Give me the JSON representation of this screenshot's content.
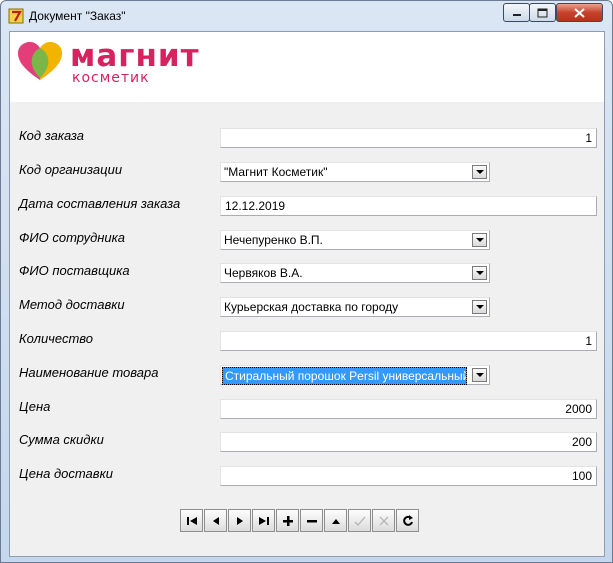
{
  "window": {
    "title": "Документ \"Заказ\""
  },
  "logo": {
    "main": "магнит",
    "sub": "косметик"
  },
  "form": {
    "order_code": {
      "label": "Код заказа",
      "value": "1"
    },
    "organization": {
      "label": "Код организации",
      "value": "\"Магнит Косметик\""
    },
    "date": {
      "label": "Дата составления заказа",
      "value": "12.12.2019"
    },
    "employee": {
      "label": "ФИО сотрудника",
      "value": "Нечепуренко В.П."
    },
    "supplier": {
      "label": "ФИО поставщика",
      "value": "Червяков В.А."
    },
    "delivery_method": {
      "label": "Метод доставки",
      "value": "Курьерская доставка по городу"
    },
    "quantity": {
      "label": "Количество",
      "value": "1"
    },
    "product": {
      "label": "Наименование товара",
      "value": "Стиральный порошок Persil универсальный с"
    },
    "price": {
      "label": "Цена",
      "value": "2000"
    },
    "discount": {
      "label": "Сумма скидки",
      "value": "200"
    },
    "delivery_price": {
      "label": "Цена доставки",
      "value": "100"
    }
  },
  "navigator": {
    "buttons": [
      "first-icon",
      "prior-icon",
      "next-icon",
      "last-icon",
      "insert-icon",
      "delete-icon",
      "edit-icon",
      "post-icon",
      "cancel-icon",
      "refresh-icon"
    ]
  }
}
